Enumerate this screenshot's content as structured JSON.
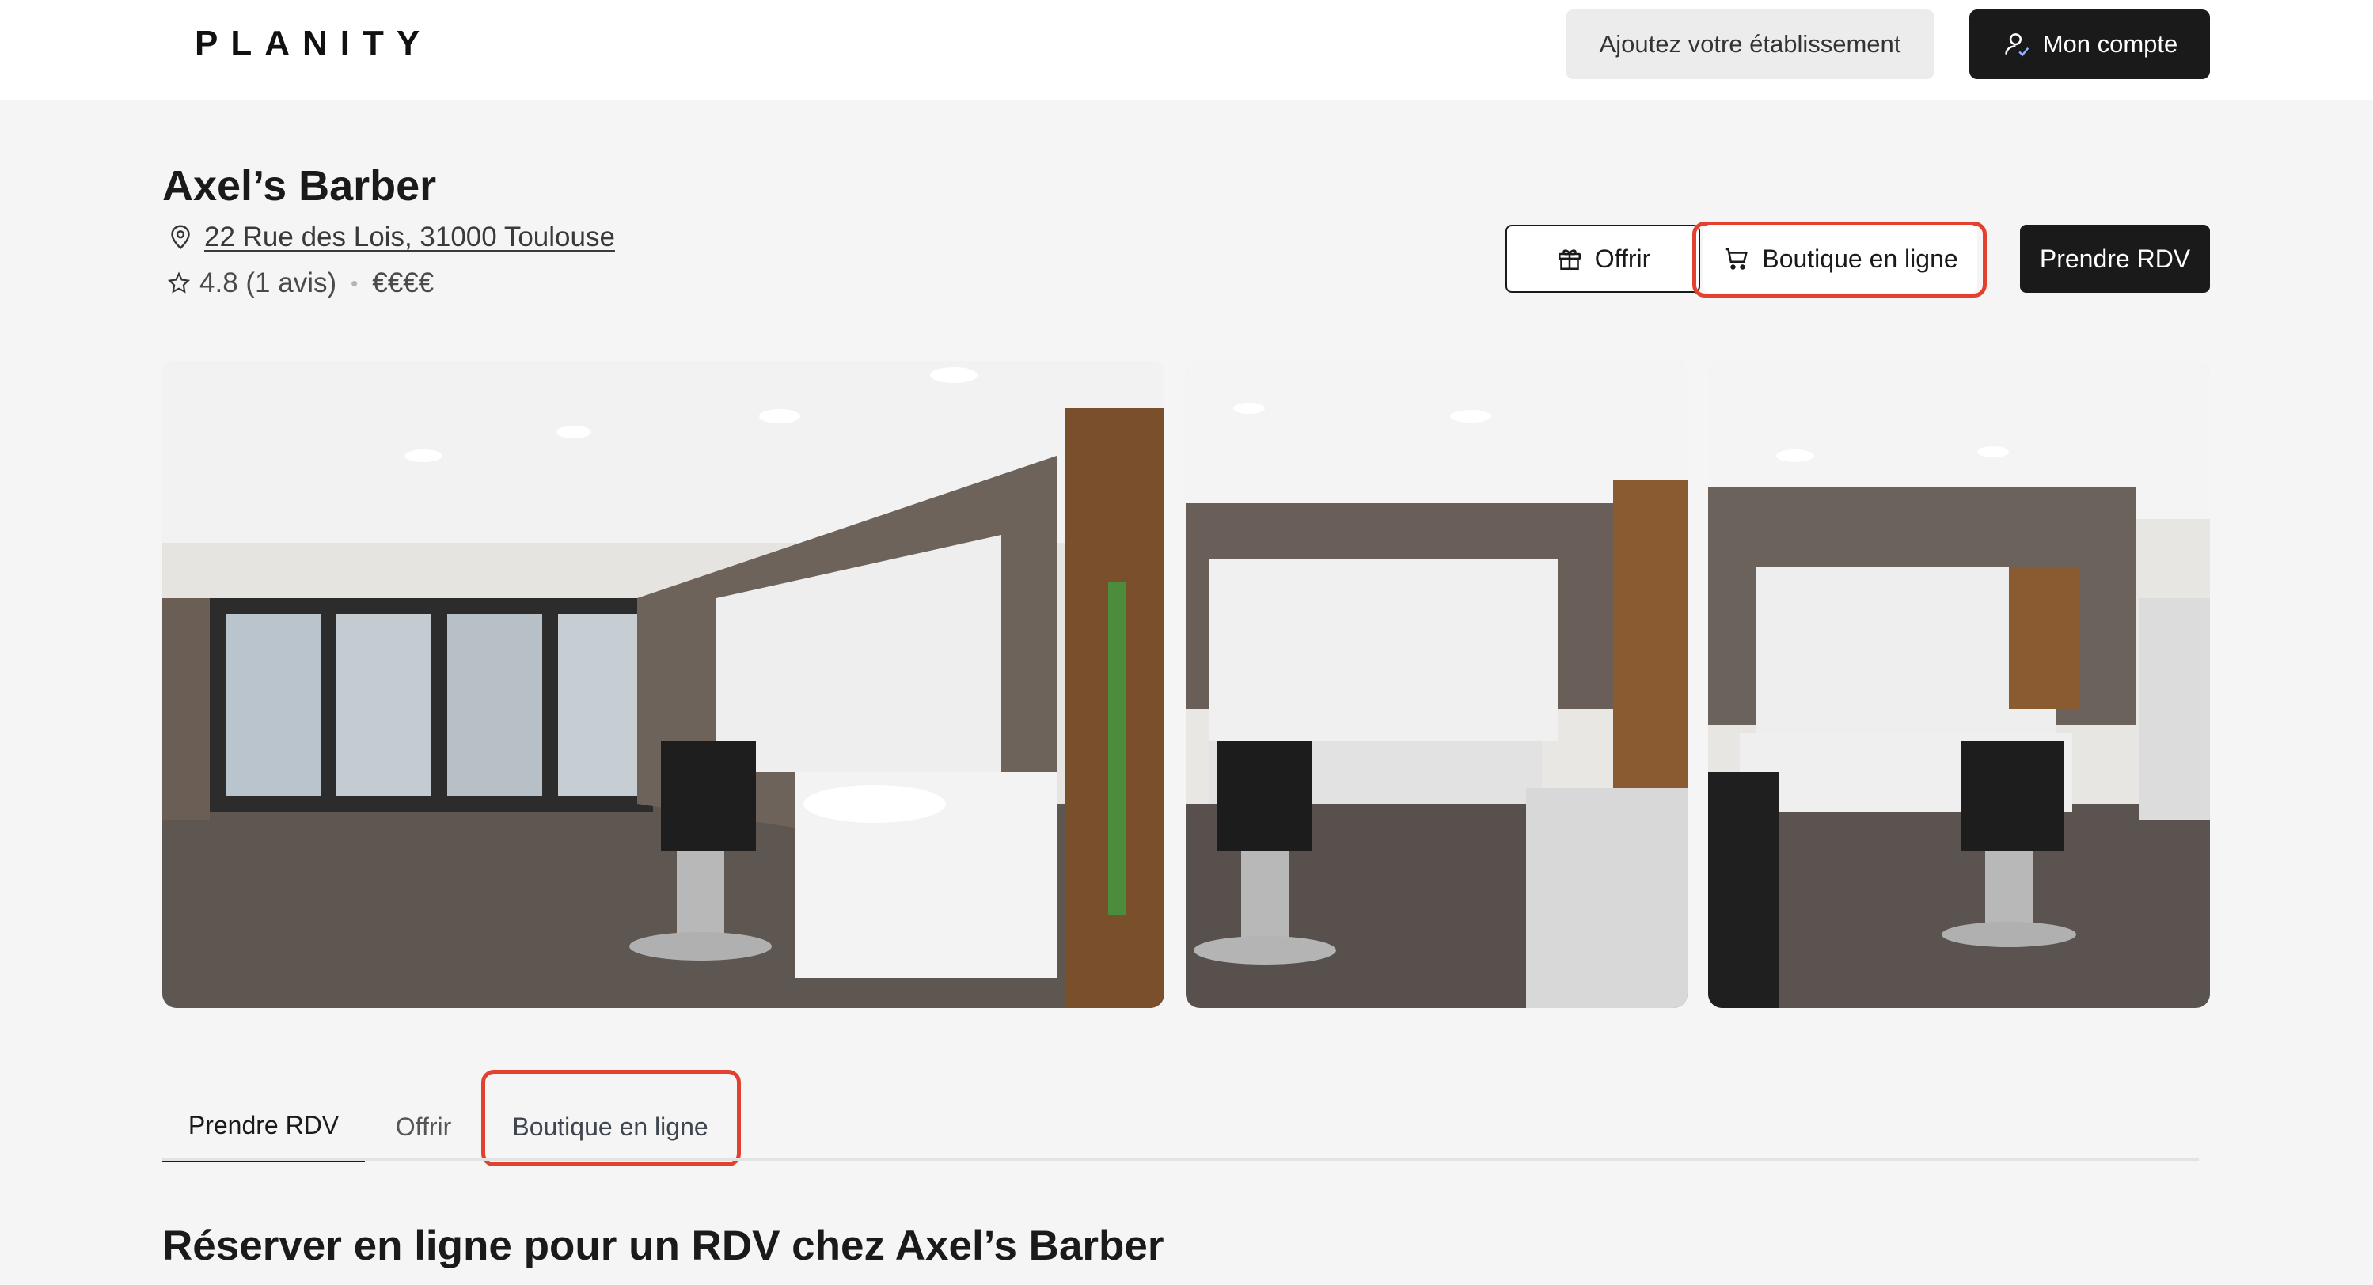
{
  "nav": {
    "logo": "PLANITY",
    "add_business": "Ajoutez votre établissement",
    "account": "Mon compte",
    "account_icon": "user-icon"
  },
  "salon": {
    "name": "Axel’s Barber",
    "address": "22 Rue des Lois, 31000 Toulouse",
    "rating": "4.8 (1 avis)",
    "price": "€€€€"
  },
  "actions": {
    "gift": "Offrir",
    "shop": "Boutique en ligne",
    "book": "Prendre RDV"
  },
  "tabs": [
    {
      "label": "Prendre RDV",
      "active": true
    },
    {
      "label": "Offrir",
      "active": false
    },
    {
      "label": "Boutique en ligne",
      "active": false
    }
  ],
  "section": {
    "title": "Réserver en ligne pour un RDV chez Axel’s Barber"
  },
  "colors": {
    "highlight": "#e2412f",
    "primary": "#1a1a1a",
    "background": "#f5f5f5"
  }
}
